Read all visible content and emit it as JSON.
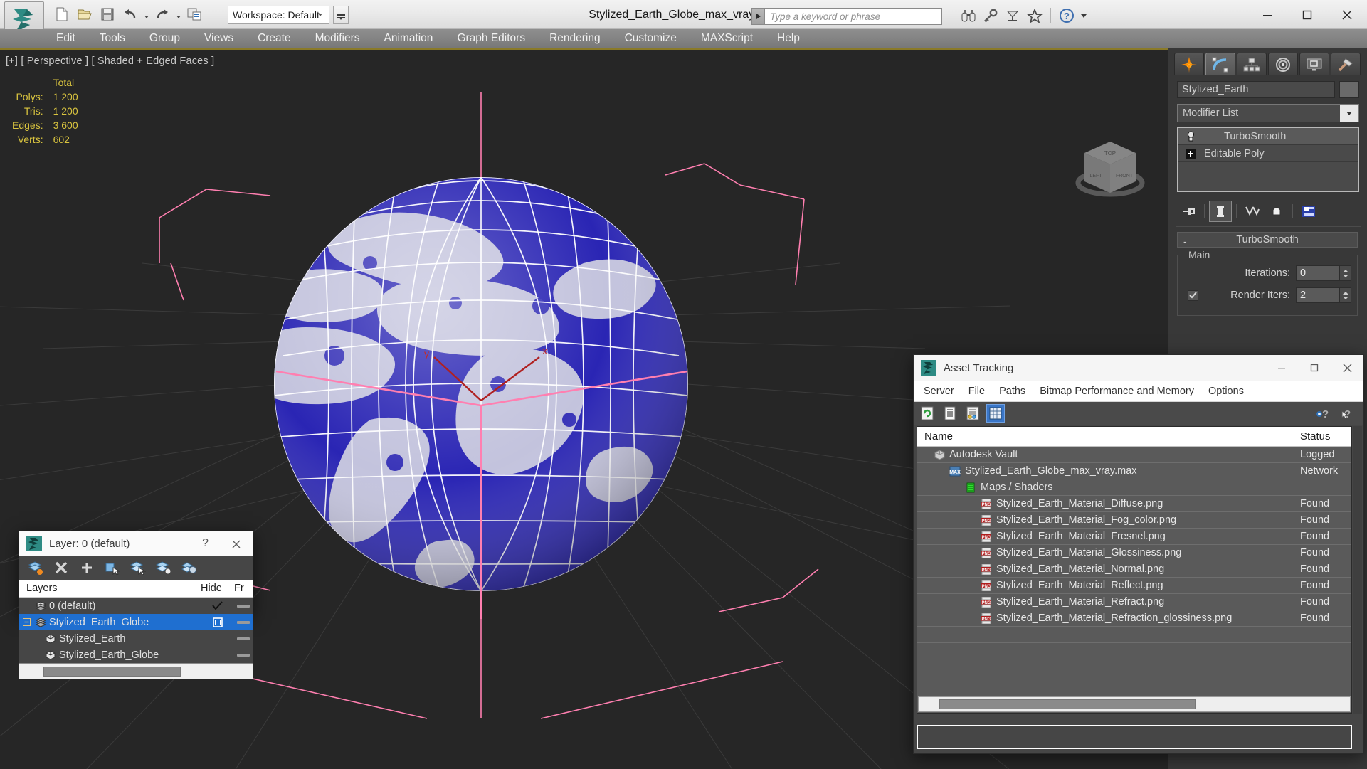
{
  "titlebar": {
    "document_title": "Stylized_Earth_Globe_max_vray.max",
    "workspace": "Workspace: Default",
    "search_placeholder": "Type a keyword or phrase",
    "quick_access": [
      {
        "name": "new-scene-icon",
        "label": "New Scene"
      },
      {
        "name": "open-file-icon",
        "label": "Open File"
      },
      {
        "name": "save-file-icon",
        "label": "Save File"
      },
      {
        "name": "undo-icon",
        "label": "Undo"
      },
      {
        "name": "redo-icon",
        "label": "Redo"
      },
      {
        "name": "project-folder-icon",
        "label": "Set Project Folder"
      }
    ],
    "right_icons": [
      {
        "name": "binoculars-icon",
        "label": "Search"
      },
      {
        "name": "key-icon",
        "label": "Sign In"
      },
      {
        "name": "satellite-dish-icon",
        "label": "Autodesk A360"
      },
      {
        "name": "star-icon",
        "label": "Favorites"
      },
      {
        "name": "help-icon",
        "label": "Help"
      }
    ],
    "window_buttons": [
      {
        "name": "minimize-button",
        "label": "Minimize"
      },
      {
        "name": "maximize-button",
        "label": "Maximize"
      },
      {
        "name": "close-button",
        "label": "Close"
      }
    ]
  },
  "menubar": {
    "items": [
      "Edit",
      "Tools",
      "Group",
      "Views",
      "Create",
      "Modifiers",
      "Animation",
      "Graph Editors",
      "Rendering",
      "Customize",
      "MAXScript",
      "Help"
    ]
  },
  "viewport": {
    "label": "[+] [ Perspective ] [ Shaded + Edged Faces ]",
    "stats": {
      "column_header": "Total",
      "rows": [
        {
          "label": "Polys:",
          "value": "1 200"
        },
        {
          "label": "Tris:",
          "value": "1 200"
        },
        {
          "label": "Edges:",
          "value": "3 600"
        },
        {
          "label": "Verts:",
          "value": "602"
        }
      ]
    },
    "axis_labels": {
      "x": "x",
      "y": "y"
    },
    "viewcube": {
      "top": "TOP",
      "left": "LEFT",
      "front": "FRONT"
    },
    "colors": {
      "background": "#262626",
      "grid": "#3a3a3a",
      "selection_bracket": "#ff7fb0",
      "globe_ocean": "#2a25b4",
      "globe_land": "#c3c3dd",
      "wireframe": "#ffffff",
      "stats_text": "#d9c43f"
    }
  },
  "command_panel": {
    "tabs": [
      {
        "name": "create-tab",
        "label": "Create",
        "active": false
      },
      {
        "name": "modify-tab",
        "label": "Modify",
        "active": true
      },
      {
        "name": "hierarchy-tab",
        "label": "Hierarchy",
        "active": false
      },
      {
        "name": "motion-tab",
        "label": "Motion",
        "active": false
      },
      {
        "name": "display-tab",
        "label": "Display",
        "active": false
      },
      {
        "name": "utilities-tab",
        "label": "Utilities",
        "active": false
      }
    ],
    "object_name": "Stylized_Earth",
    "modifier_list_label": "Modifier List",
    "stack": [
      {
        "label": "TurboSmooth",
        "selected": true
      },
      {
        "label": "Editable Poly",
        "selected": false
      }
    ],
    "stack_tools": [
      {
        "name": "pin-stack-icon",
        "label": "Pin Stack"
      },
      {
        "name": "show-end-result-icon",
        "label": "Show End Result"
      },
      {
        "name": "make-unique-icon",
        "label": "Make Unique"
      },
      {
        "name": "remove-modifier-icon",
        "label": "Remove Modifier"
      },
      {
        "name": "configure-modifier-sets-icon",
        "label": "Configure Modifier Sets"
      }
    ],
    "rollout": {
      "title": "TurboSmooth",
      "collapse_marker": "-",
      "group_title": "Main",
      "iterations_label": "Iterations:",
      "iterations_value": "0",
      "render_iters_label": "Render Iters:",
      "render_iters_value": "2",
      "render_iters_checked": true
    }
  },
  "layer_dialog": {
    "title": "Layer: 0 (default)",
    "help_glyph": "?",
    "toolbar": [
      {
        "name": "create-new-layer-icon",
        "label": "Create New Layer"
      },
      {
        "name": "delete-layer-icon",
        "label": "Delete Highlighted Empty Layers"
      },
      {
        "name": "add-selection-to-layer-icon",
        "label": "Add Selection to Highlighted Layer"
      },
      {
        "name": "select-objects-in-layer-icon",
        "label": "Select Objects in Highlighted Layers"
      },
      {
        "name": "highlight-selected-objects-layer-icon",
        "label": "Highlight Selected Objects Layers"
      },
      {
        "name": "set-current-layer-icon",
        "label": "Set Current Layer to Selection's Layer"
      },
      {
        "name": "layer-settings-icon",
        "label": "Layer Settings"
      }
    ],
    "columns": [
      "Layers",
      "Hide",
      "Fr"
    ],
    "rows": [
      {
        "name": "0 (default)",
        "indent": 0,
        "icon": "layer-icon",
        "selected": false,
        "expandable": false,
        "hide": "check",
        "freeze": "dash"
      },
      {
        "name": "Stylized_Earth_Globe",
        "indent": 0,
        "icon": "layer-icon",
        "selected": true,
        "expandable": true,
        "expanded": true,
        "hide": "box",
        "freeze": "dash"
      },
      {
        "name": "Stylized_Earth",
        "indent": 1,
        "icon": "object-icon",
        "selected": false,
        "expandable": false,
        "hide": "",
        "freeze": "dash"
      },
      {
        "name": "Stylized_Earth_Globe",
        "indent": 1,
        "icon": "object-icon",
        "selected": false,
        "expandable": false,
        "hide": "",
        "freeze": "dash"
      }
    ]
  },
  "asset_tracking": {
    "title": "Asset Tracking",
    "menus": [
      "Server",
      "File",
      "Paths",
      "Bitmap Performance and Memory",
      "Options"
    ],
    "toolbar": [
      {
        "name": "refresh-icon",
        "label": "Refresh",
        "active": false
      },
      {
        "name": "list-view-icon",
        "label": "List View",
        "active": false
      },
      {
        "name": "detail-view-icon",
        "label": "Detail View",
        "active": false
      },
      {
        "name": "grid-view-icon",
        "label": "Grid View",
        "active": true
      }
    ],
    "toolbar_right": [
      {
        "name": "help-add-icon",
        "label": "Help"
      },
      {
        "name": "context-help-icon",
        "label": "Context Help"
      }
    ],
    "columns": [
      "Name",
      "Status"
    ],
    "rows": [
      {
        "name": "Autodesk Vault",
        "status": "Logged",
        "indent": 0,
        "icon": "vault-icon"
      },
      {
        "name": "Stylized_Earth_Globe_max_vray.max",
        "status": "Network",
        "indent": 1,
        "icon": "max-file-icon"
      },
      {
        "name": "Maps / Shaders",
        "status": "",
        "indent": 2,
        "icon": "maps-shaders-icon"
      },
      {
        "name": "Stylized_Earth_Material_Diffuse.png",
        "status": "Found",
        "indent": 3,
        "icon": "png-icon"
      },
      {
        "name": "Stylized_Earth_Material_Fog_color.png",
        "status": "Found",
        "indent": 3,
        "icon": "png-icon"
      },
      {
        "name": "Stylized_Earth_Material_Fresnel.png",
        "status": "Found",
        "indent": 3,
        "icon": "png-icon"
      },
      {
        "name": "Stylized_Earth_Material_Glossiness.png",
        "status": "Found",
        "indent": 3,
        "icon": "png-icon"
      },
      {
        "name": "Stylized_Earth_Material_Normal.png",
        "status": "Found",
        "indent": 3,
        "icon": "png-icon"
      },
      {
        "name": "Stylized_Earth_Material_Reflect.png",
        "status": "Found",
        "indent": 3,
        "icon": "png-icon"
      },
      {
        "name": "Stylized_Earth_Material_Refract.png",
        "status": "Found",
        "indent": 3,
        "icon": "png-icon"
      },
      {
        "name": "Stylized_Earth_Material_Refraction_glossiness.png",
        "status": "Found",
        "indent": 3,
        "icon": "png-icon"
      },
      {
        "name": "",
        "status": "",
        "indent": 0,
        "icon": ""
      }
    ],
    "window_buttons": [
      {
        "name": "minimize-button",
        "label": "Minimize"
      },
      {
        "name": "maximize-button",
        "label": "Maximize"
      },
      {
        "name": "close-button",
        "label": "Close"
      }
    ]
  }
}
